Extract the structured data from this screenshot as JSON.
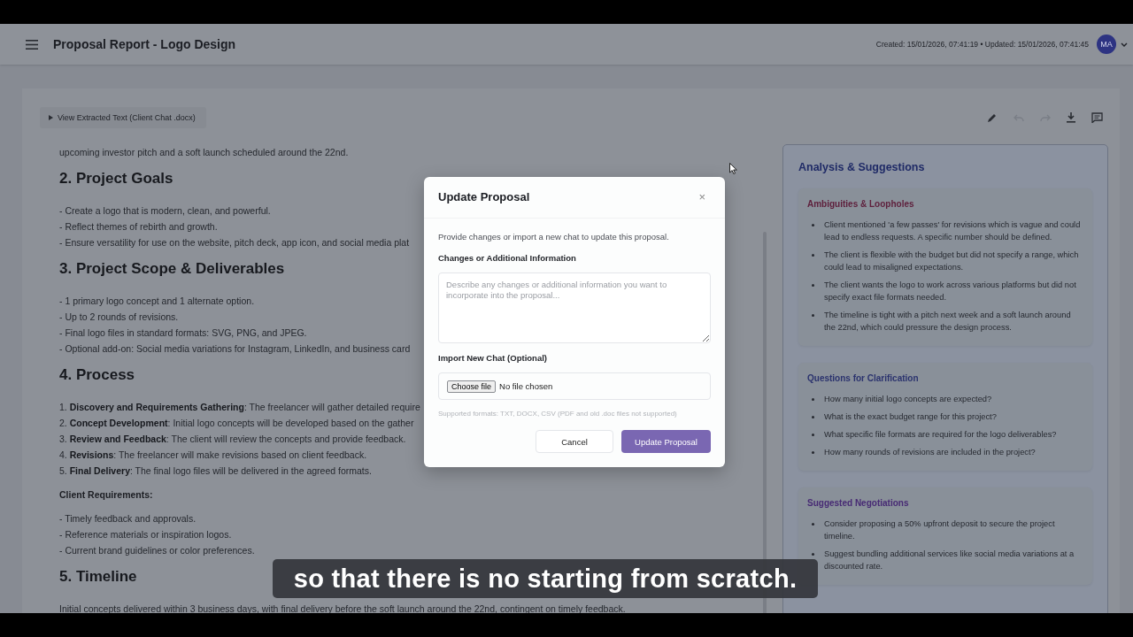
{
  "header": {
    "title": "Proposal Report - Logo Design",
    "timestamps": "Created: 15/01/2026, 07:41:19 • Updated: 15/01/2026, 07:41:45",
    "avatar": "MA"
  },
  "toolbar": {
    "toggle_label": "View Extracted Text (Client Chat .docx)",
    "actions": [
      {
        "kind": "edit",
        "disabled": false
      },
      {
        "kind": "undo",
        "disabled": true
      },
      {
        "kind": "redo",
        "disabled": true
      },
      {
        "kind": "download",
        "disabled": false
      },
      {
        "kind": "comment",
        "disabled": false
      }
    ]
  },
  "document": [
    {
      "kind": "paragraph",
      "text": "upcoming investor pitch and a soft launch scheduled around the 22nd."
    },
    {
      "kind": "heading",
      "text": "2. Project Goals"
    },
    {
      "kind": "list",
      "lines": [
        "- Create a logo that is modern, clean, and powerful.",
        "- Reflect themes of rebirth and growth.",
        "- Ensure versatility for use on the website, pitch deck, app icon, and social media plat"
      ]
    },
    {
      "kind": "heading",
      "text": "3. Project Scope & Deliverables"
    },
    {
      "kind": "list",
      "lines": [
        "- 1 primary logo concept and 1 alternate option.",
        "- Up to 2 rounds of revisions.",
        "- Final logo files in standard formats: SVG, PNG, and JPEG.",
        "- Optional add-on: Social media variations for Instagram, LinkedIn, and business card"
      ]
    },
    {
      "kind": "heading",
      "text": "4. Process"
    },
    {
      "kind": "list",
      "lines": [
        "1. **Discovery and Requirements Gathering**: The freelancer will gather detailed require",
        "2. **Concept Development**: Initial logo concepts will be developed based on the gather",
        "3. **Review and Feedback**: The client will review the concepts and provide feedback.",
        "4. **Revisions**: The freelancer will make revisions based on client feedback.",
        "5. **Final Delivery**: The final logo files will be delivered in the agreed formats."
      ]
    },
    {
      "kind": "label",
      "text": "Client Requirements:"
    },
    {
      "kind": "list",
      "lines": [
        "- Timely feedback and approvals.",
        "- Reference materials or inspiration logos.",
        "- Current brand guidelines or color preferences."
      ]
    },
    {
      "kind": "heading",
      "text": "5. Timeline"
    },
    {
      "kind": "paragraph",
      "text": "Initial concepts delivered within 3 business days, with final delivery before the soft launch around the 22nd, contingent on timely feedback."
    }
  ],
  "analysis": {
    "title": "Analysis & Suggestions",
    "sections": [
      {
        "title": "Ambiguities & Loopholes",
        "color": "#5e1f3c",
        "items": [
          "Client mentioned 'a few passes' for revisions which is vague and could lead to endless requests. A specific number should be defined.",
          "The client is flexible with the budget but did not specify a range, which could lead to misaligned expectations.",
          "The client wants the logo to work across various platforms but did not specify exact file formats needed.",
          "The timeline is tight with a pitch next week and a soft launch around the 22nd, which could pressure the design process."
        ]
      },
      {
        "title": "Questions for Clarification",
        "color": "#2b336e",
        "items": [
          "How many initial logo concepts are expected?",
          "What is the exact budget range for this project?",
          "What specific file formats are required for the logo deliverables?",
          "How many rounds of revisions are included in the project?"
        ]
      },
      {
        "title": "Suggested Negotiations",
        "color": "#472a74",
        "items": [
          "Consider proposing a 50% upfront deposit to secure the project timeline.",
          "Suggest bundling additional services like social media variations at a discounted rate."
        ]
      }
    ]
  },
  "modal": {
    "title": "Update Proposal",
    "close": "×",
    "description": "Provide changes or import a new chat to update this proposal.",
    "changes_label": "Changes or Additional Information",
    "changes_placeholder": "Describe any changes or additional information you want to incorporate into the proposal...",
    "import_label": "Import New Chat (Optional)",
    "file_button": "Choose file",
    "file_status": "No file chosen",
    "hint": "Supported formats: TXT, DOCX, CSV (PDF and old .doc files not supported)",
    "cancel": "Cancel",
    "submit": "Update Proposal"
  },
  "subtitle": "so that there is no starting from scratch."
}
